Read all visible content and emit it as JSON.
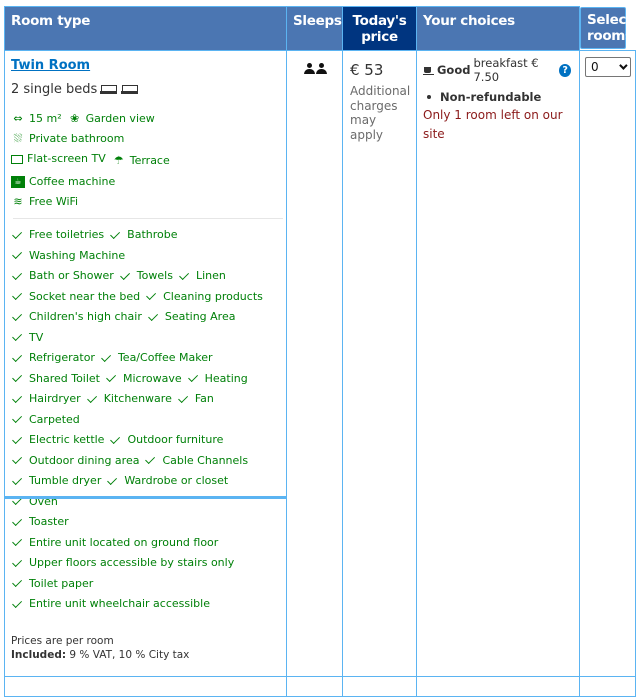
{
  "header": {
    "room_type": "Room type",
    "sleeps": "Sleeps",
    "price": "Today's price",
    "choices": "Your choices",
    "select": "Select rooms"
  },
  "room": {
    "name": "Twin Room",
    "beds": "2 single beds",
    "facilities": [
      {
        "icon": "size-icon",
        "glyph": "⇔",
        "label": "15 m²"
      },
      {
        "icon": "garden-view-icon",
        "glyph": "❀",
        "label": "Garden view"
      },
      {
        "icon": "shower-icon",
        "glyph": "⛆",
        "label": "Private bathroom"
      },
      {
        "icon": "tv-icon",
        "glyph": "",
        "label": "Flat-screen TV"
      },
      {
        "icon": "terrace-icon",
        "glyph": "☂",
        "label": "Terrace"
      },
      {
        "icon": "coffee-machine-icon",
        "glyph": "☕",
        "label": "Coffee machine"
      },
      {
        "icon": "wifi-icon",
        "glyph": "≋",
        "label": "Free WiFi"
      }
    ],
    "amenity_rows": [
      [
        "Free toiletries",
        "Bathrobe",
        "Washing Machine"
      ],
      [
        "Bath or Shower",
        "Towels",
        "Linen"
      ],
      [
        "Socket near the bed",
        "Cleaning products"
      ],
      [
        "Children's high chair",
        "Seating Area",
        "TV"
      ],
      [
        "Refrigerator",
        "Tea/Coffee Maker"
      ],
      [
        "Shared Toilet",
        "Microwave",
        "Heating"
      ],
      [
        "Hairdryer",
        "Kitchenware",
        "Fan",
        "Carpeted"
      ],
      [
        "Electric kettle",
        "Outdoor furniture"
      ],
      [
        "Outdoor dining area",
        "Cable Channels"
      ],
      [
        "Tumble dryer",
        "Wardrobe or closet",
        "Oven"
      ],
      [
        "Toaster",
        "Entire unit located on ground floor"
      ],
      [
        "Upper floors accessible by stairs only"
      ],
      [
        "Toilet paper",
        "Entire unit wheelchair accessible"
      ]
    ],
    "price_note": "Prices are per room",
    "included_label": "Included:",
    "included_value": " 9 % VAT, 10 % City tax",
    "sleeps_count": 2,
    "price": "€ 53",
    "extra_charges": "Additional charges may apply",
    "breakfast_quality": "Good",
    "breakfast_text": "breakfast € 7.50",
    "help_glyph": "?",
    "policy": "Non-refundable",
    "scarcity": "Only 1 room left on our site",
    "selected_rooms": "0"
  },
  "colors": {
    "header_bg": "#4b76b2",
    "price_header_bg": "#003580",
    "border": "#5bb4f2",
    "link": "#0071c2",
    "facility_green": "#008009",
    "scarcity_red": "#8b1a1a"
  }
}
